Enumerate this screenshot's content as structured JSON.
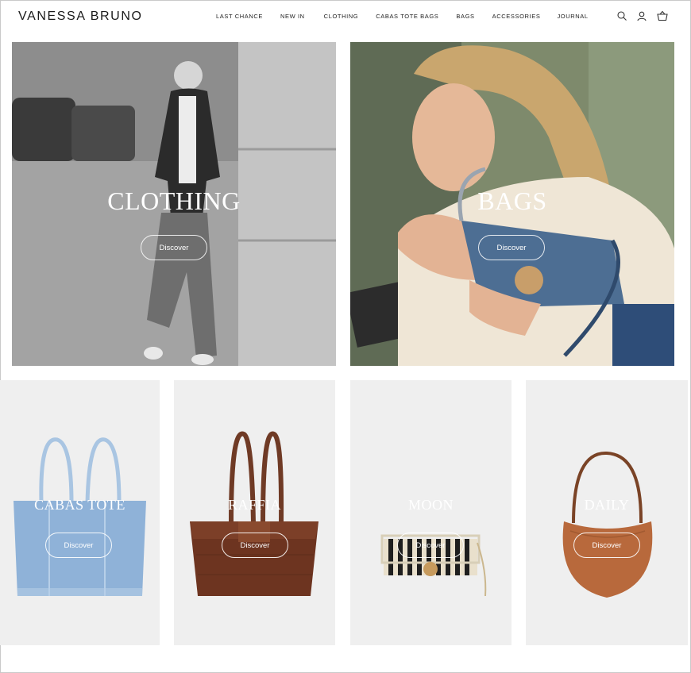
{
  "brand": {
    "logo": "VANESSA BRUNO"
  },
  "nav": {
    "items": [
      "LAST CHANCE",
      "NEW IN",
      "CLOTHING",
      "CABAS TOTE BAGS",
      "BAGS",
      "ACCESSORIES",
      "JOURNAL"
    ]
  },
  "header_icons": [
    "search-icon",
    "account-icon",
    "basket-icon"
  ],
  "hero": [
    {
      "title": "CLOTHING",
      "button": "Discover"
    },
    {
      "title": "BAGS",
      "button": "Discover"
    }
  ],
  "tiles": [
    {
      "title": "CABAS TOTE",
      "button": "Discover"
    },
    {
      "title": "RAFFIA",
      "button": "Discover"
    },
    {
      "title": "MOON",
      "button": "Discover"
    },
    {
      "title": "DAILY",
      "button": "Discover"
    }
  ],
  "colors": {
    "accent": "#ffffff",
    "text": "#222222",
    "tile_bg": "#efefef"
  }
}
